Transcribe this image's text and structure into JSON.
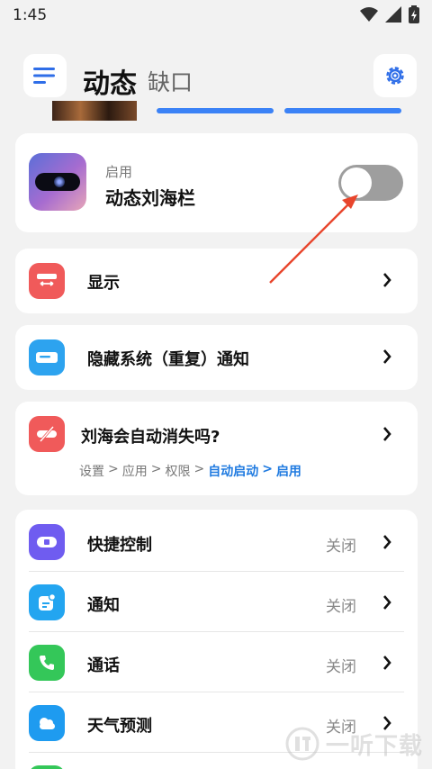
{
  "status_bar": {
    "time": "1:45"
  },
  "header": {
    "title": "动态",
    "subtitle": "缺口"
  },
  "enable_card": {
    "small_label": "启用",
    "title": "动态刘海栏",
    "toggle_on": false
  },
  "rows": {
    "display": {
      "label": "显示",
      "icon": "display-icon",
      "color": "#f05a5a"
    },
    "hide_notify": {
      "label": "隐藏系统（重复）通知",
      "icon": "notification-bar-icon",
      "color": "#2da3ef"
    }
  },
  "notch_card": {
    "label": "刘海会自动消失吗?",
    "path": [
      "设置",
      ">",
      "应用",
      ">",
      "权限",
      ">",
      "自动启动",
      ">",
      "启用"
    ]
  },
  "list": [
    {
      "label": "快捷控制",
      "status": "关闭",
      "icon": "quick-control-icon",
      "color": "#6f5cf0"
    },
    {
      "label": "通知",
      "status": "关闭",
      "icon": "notification-icon",
      "color": "#23a5f0"
    },
    {
      "label": "通话",
      "status": "关闭",
      "icon": "phone-icon",
      "color": "#34c759"
    },
    {
      "label": "天气预测",
      "status": "关闭",
      "icon": "weather-icon",
      "color": "#1e9bf0"
    }
  ],
  "watermark": {
    "text": "一听下载"
  },
  "colors": {
    "accent": "#1f7ae0",
    "annotation_arrow": "#e8452c"
  }
}
